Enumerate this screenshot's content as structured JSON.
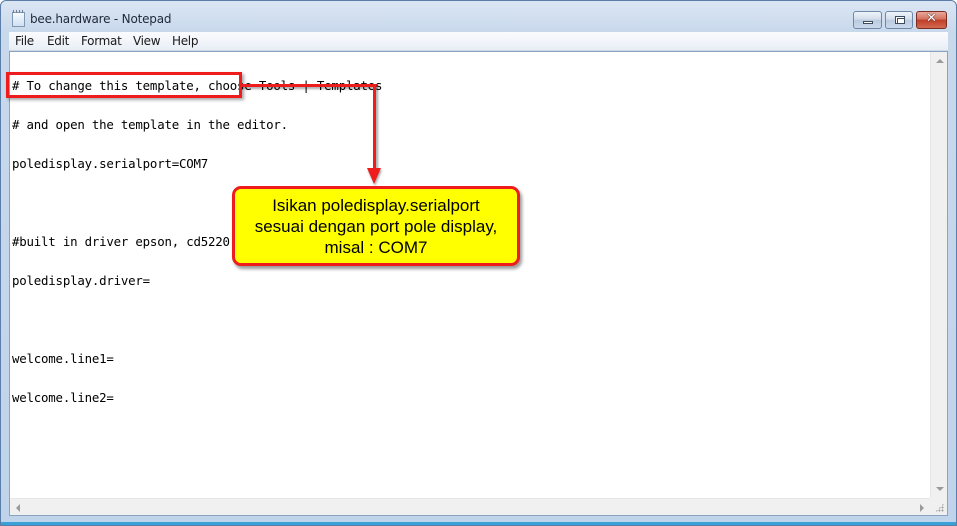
{
  "window": {
    "title": "bee.hardware - Notepad",
    "icon": "notepad-icon",
    "controls": {
      "minimize": "minimize-icon",
      "maximize": "maximize-icon",
      "close": "✕"
    }
  },
  "menu": {
    "items": [
      "File",
      "Edit",
      "Format",
      "View",
      "Help"
    ]
  },
  "editor": {
    "lines": [
      "# To change this template, choose Tools | Templates",
      "# and open the template in the editor.",
      "poledisplay.serialport=COM7",
      "",
      "#built in driver epson, cd5220, pos7300",
      "poledisplay.driver=",
      "",
      "welcome.line1=",
      "welcome.line2="
    ]
  },
  "annotation": {
    "highlighted_text": "poledisplay.serialport=COM7",
    "callout_lines": [
      "Isikan poledisplay.serialport",
      "sesuai dengan port pole display,",
      "misal : COM7"
    ],
    "colors": {
      "border": "#ee1c1c",
      "fill": "#ffff00"
    }
  }
}
